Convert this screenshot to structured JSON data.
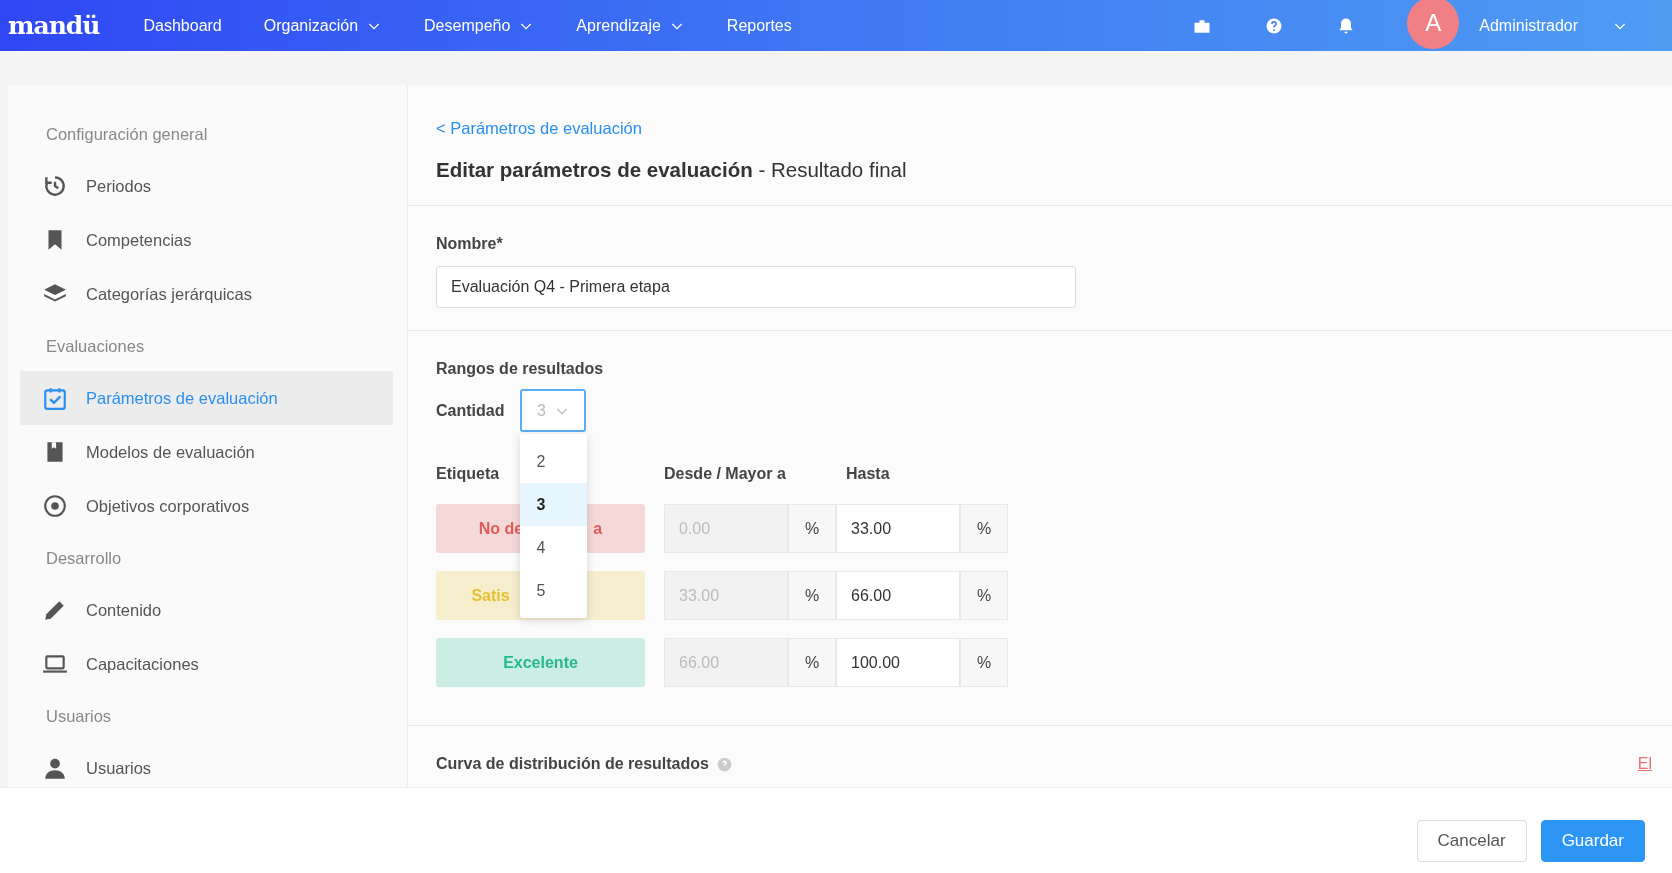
{
  "brand": "mandü",
  "nav": [
    {
      "label": "Dashboard",
      "dropdown": false
    },
    {
      "label": "Organización",
      "dropdown": true
    },
    {
      "label": "Desempeño",
      "dropdown": true
    },
    {
      "label": "Aprendizaje",
      "dropdown": true
    },
    {
      "label": "Reportes",
      "dropdown": false
    }
  ],
  "user": {
    "initial": "A",
    "name": "Administrador"
  },
  "sidebar": [
    {
      "header": "Configuración general",
      "items": [
        {
          "label": "Periodos",
          "selected": false
        },
        {
          "label": "Competencias",
          "selected": false
        },
        {
          "label": "Categorías jerárquicas",
          "selected": false
        }
      ]
    },
    {
      "header": "Evaluaciones",
      "items": [
        {
          "label": "Parámetros de evaluación",
          "selected": true
        },
        {
          "label": "Modelos de evaluación",
          "selected": false
        },
        {
          "label": "Objetivos corporativos",
          "selected": false
        }
      ]
    },
    {
      "header": "Desarrollo",
      "items": [
        {
          "label": "Contenido",
          "selected": false
        },
        {
          "label": "Capacitaciones",
          "selected": false
        }
      ]
    },
    {
      "header": "Usuarios",
      "items": [
        {
          "label": "Usuarios",
          "selected": false
        }
      ]
    }
  ],
  "back_link": "< Parámetros de evaluación",
  "title": "Editar parámetros de evaluación",
  "subtitle": "- Resultado final",
  "name_field": {
    "label": "Nombre*",
    "value": "Evaluación Q4 - Primera etapa"
  },
  "ranges": {
    "title": "Rangos de resultados",
    "quantity_label": "Cantidad",
    "quantity_value": "3",
    "options": [
      {
        "label": "2",
        "selected": false
      },
      {
        "label": "3",
        "selected": true
      },
      {
        "label": "4",
        "selected": false
      },
      {
        "label": "5",
        "selected": false
      }
    ],
    "columns": [
      "Etiqueta",
      "Desde / Mayor a",
      "Hasta"
    ],
    "rows": [
      {
        "label_parts": [
          "No de",
          "a"
        ],
        "covered": true,
        "color": "#e05a5a",
        "from": "0.00",
        "from_unit": "%",
        "to": "33.00",
        "to_unit": "%"
      },
      {
        "label_parts": [
          "Satis"
        ],
        "covered": true,
        "color": "#e6c02e",
        "from": "33.00",
        "from_unit": "%",
        "to": "66.00",
        "to_unit": "%"
      },
      {
        "label_parts": [
          "Excelente"
        ],
        "covered": false,
        "color": "#26b98c",
        "from": "66.00",
        "from_unit": "%",
        "to": "100.00",
        "to_unit": "%"
      }
    ]
  },
  "curve": {
    "title": "Curva de distribución de resultados",
    "link": "El"
  },
  "buttons": [
    {
      "label": "Cancelar",
      "kind": "secondary"
    },
    {
      "label": "Guardar",
      "kind": "primary"
    }
  ]
}
